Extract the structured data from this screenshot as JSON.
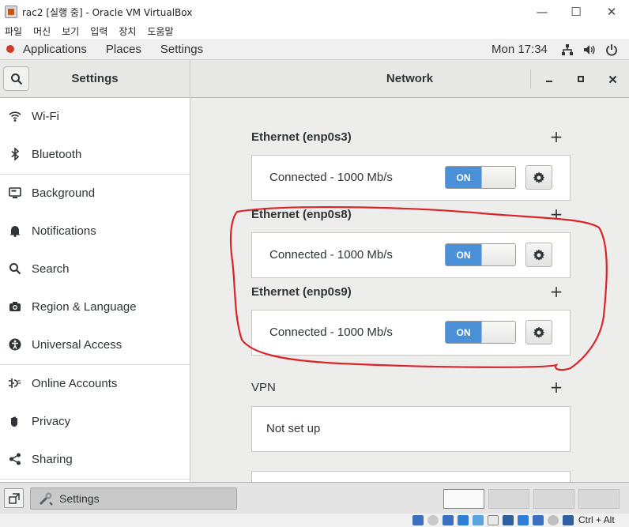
{
  "vbox": {
    "window_title": "rac2 [실행 중] - Oracle VM VirtualBox",
    "menu": [
      "파일",
      "머신",
      "보기",
      "입력",
      "장치",
      "도움말"
    ],
    "host_key": "Ctrl + Alt",
    "status_icons": [
      "disk-icon",
      "optical-icon",
      "audio-icon",
      "network-icon",
      "usb-icon",
      "shared-folder-icon",
      "display-icon",
      "recording-icon",
      "cpu-icon",
      "mouse-icon",
      "keyboard-icon"
    ]
  },
  "topbar": {
    "applications": "Applications",
    "places": "Places",
    "settings": "Settings",
    "clock": "Mon 17:34",
    "tray_icons": [
      "network-tray-icon",
      "volume-icon",
      "power-icon"
    ]
  },
  "header": {
    "left_title": "Settings",
    "right_title": "Network",
    "buttons": [
      "minimize-icon",
      "maximize-icon",
      "close-icon"
    ]
  },
  "sidebar": {
    "items": [
      {
        "label": "Wi-Fi",
        "icon": "wifi-icon"
      },
      {
        "label": "Bluetooth",
        "icon": "bluetooth-icon"
      },
      {
        "label": "Background",
        "icon": "background-icon"
      },
      {
        "label": "Notifications",
        "icon": "bell-icon"
      },
      {
        "label": "Search",
        "icon": "search-icon"
      },
      {
        "label": "Region & Language",
        "icon": "camera-icon"
      },
      {
        "label": "Universal Access",
        "icon": "accessibility-icon"
      },
      {
        "label": "Online Accounts",
        "icon": "online-accounts-icon"
      },
      {
        "label": "Privacy",
        "icon": "hand-icon"
      },
      {
        "label": "Sharing",
        "icon": "share-icon"
      }
    ]
  },
  "network": {
    "sections": [
      {
        "title": "Ethernet (enp0s3)",
        "status": "Connected - 1000 Mb/s",
        "toggle": "ON"
      },
      {
        "title": "Ethernet (enp0s8)",
        "status": "Connected - 1000 Mb/s",
        "toggle": "ON"
      },
      {
        "title": "Ethernet (enp0s9)",
        "status": "Connected - 1000 Mb/s",
        "toggle": "ON"
      }
    ],
    "vpn": {
      "title": "VPN",
      "status": "Not set up"
    }
  },
  "taskbar": {
    "task_label": "Settings",
    "workspaces": 4,
    "active_workspace": 1
  },
  "colors": {
    "toggle_on": "#4a90d9",
    "annotation": "#d9242a",
    "content_bg": "#ededec"
  }
}
